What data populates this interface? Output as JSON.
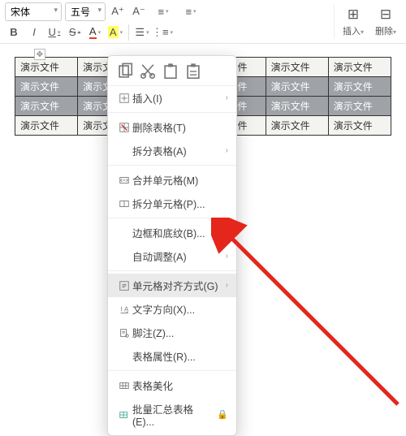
{
  "toolbar": {
    "font_name": "宋体",
    "font_size": "五号",
    "bold": "B",
    "italic": "I",
    "underline": "U",
    "strike": "S",
    "font_plus": "A⁺",
    "font_minus": "A⁻",
    "insert_label": "插入",
    "delete_label": "删除"
  },
  "table": {
    "cell_text": "演示文件",
    "rows": 4,
    "cols": 6
  },
  "context_menu": {
    "quick": {
      "copy": "⎘",
      "cut": "✂",
      "paste": "📋",
      "paste_special": "🗀"
    },
    "items": [
      {
        "label": "插入(I)",
        "icon": "insert",
        "arrow": true
      },
      {
        "label": "删除表格(T)",
        "icon": "delete-table",
        "arrow": false
      },
      {
        "label": "拆分表格(A)",
        "icon": "",
        "arrow": true
      },
      {
        "label": "合并单元格(M)",
        "icon": "merge",
        "arrow": false
      },
      {
        "label": "拆分单元格(P)...",
        "icon": "split",
        "arrow": false
      },
      {
        "label": "边框和底纹(B)...",
        "icon": "",
        "arrow": false
      },
      {
        "label": "自动调整(A)",
        "icon": "",
        "arrow": true
      },
      {
        "label": "单元格对齐方式(G)",
        "icon": "align",
        "arrow": true,
        "highlight": true
      },
      {
        "label": "文字方向(X)...",
        "icon": "text-dir",
        "arrow": false
      },
      {
        "label": "脚注(Z)...",
        "icon": "footnote",
        "arrow": false
      },
      {
        "label": "表格属性(R)...",
        "icon": "",
        "arrow": false
      },
      {
        "label": "表格美化",
        "icon": "beautify",
        "arrow": false
      },
      {
        "label": "批量汇总表格(E)...",
        "icon": "batch",
        "arrow": false,
        "lock": true
      }
    ]
  }
}
